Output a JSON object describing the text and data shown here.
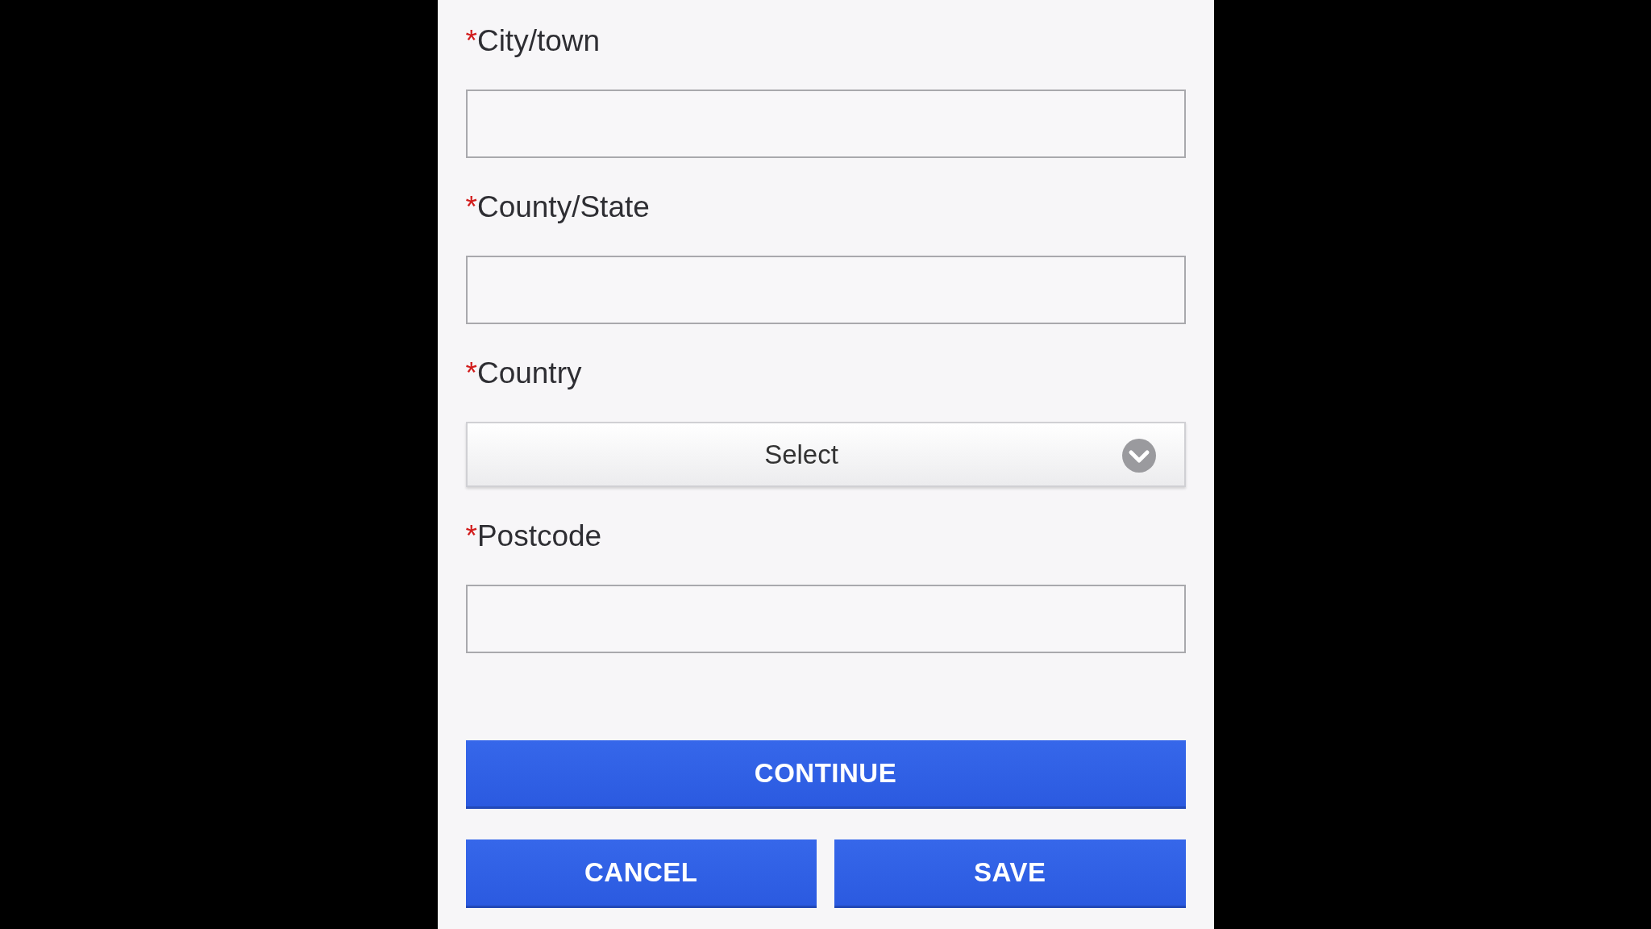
{
  "fields": [
    {
      "kind": "text",
      "required_mark": "*",
      "label": "City/town"
    },
    {
      "kind": "text",
      "required_mark": "*",
      "label": "County/State"
    },
    {
      "kind": "select",
      "required_mark": "*",
      "label": "Country",
      "value": "Select"
    },
    {
      "kind": "text",
      "required_mark": "*",
      "label": "Postcode"
    }
  ],
  "primary_button": {
    "label": "CONTINUE"
  },
  "secondary_buttons": [
    {
      "label": "CANCEL"
    },
    {
      "label": "SAVE"
    }
  ]
}
